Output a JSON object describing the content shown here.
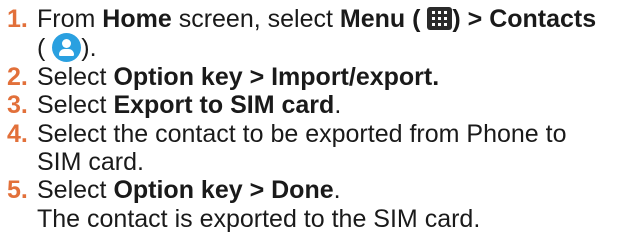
{
  "colors": {
    "number": "#e2703a",
    "text": "#1a1a1a",
    "contacts_icon": "#2aa0e0"
  },
  "icons": {
    "menu": "menu-grid-icon",
    "contacts": "contacts-icon"
  },
  "steps": [
    {
      "number": "1.",
      "t1": "From ",
      "b1": "Home",
      "t2": " screen, select ",
      "b2": "Menu (",
      "b3": ") > Contacts",
      "t3": "(",
      "t4": ")."
    },
    {
      "number": "2.",
      "t1": "Select ",
      "b1": "Option key > Import/export."
    },
    {
      "number": "3.",
      "t1": "Select ",
      "b1": "Export to SIM card",
      "t2": "."
    },
    {
      "number": "4.",
      "line1": "Select the contact to be exported from Phone to",
      "line2": "SIM card."
    },
    {
      "number": "5.",
      "t1": "Select ",
      "b1": "Option key > Done",
      "t2": ".",
      "line2": "The contact is exported to the SIM card."
    }
  ]
}
